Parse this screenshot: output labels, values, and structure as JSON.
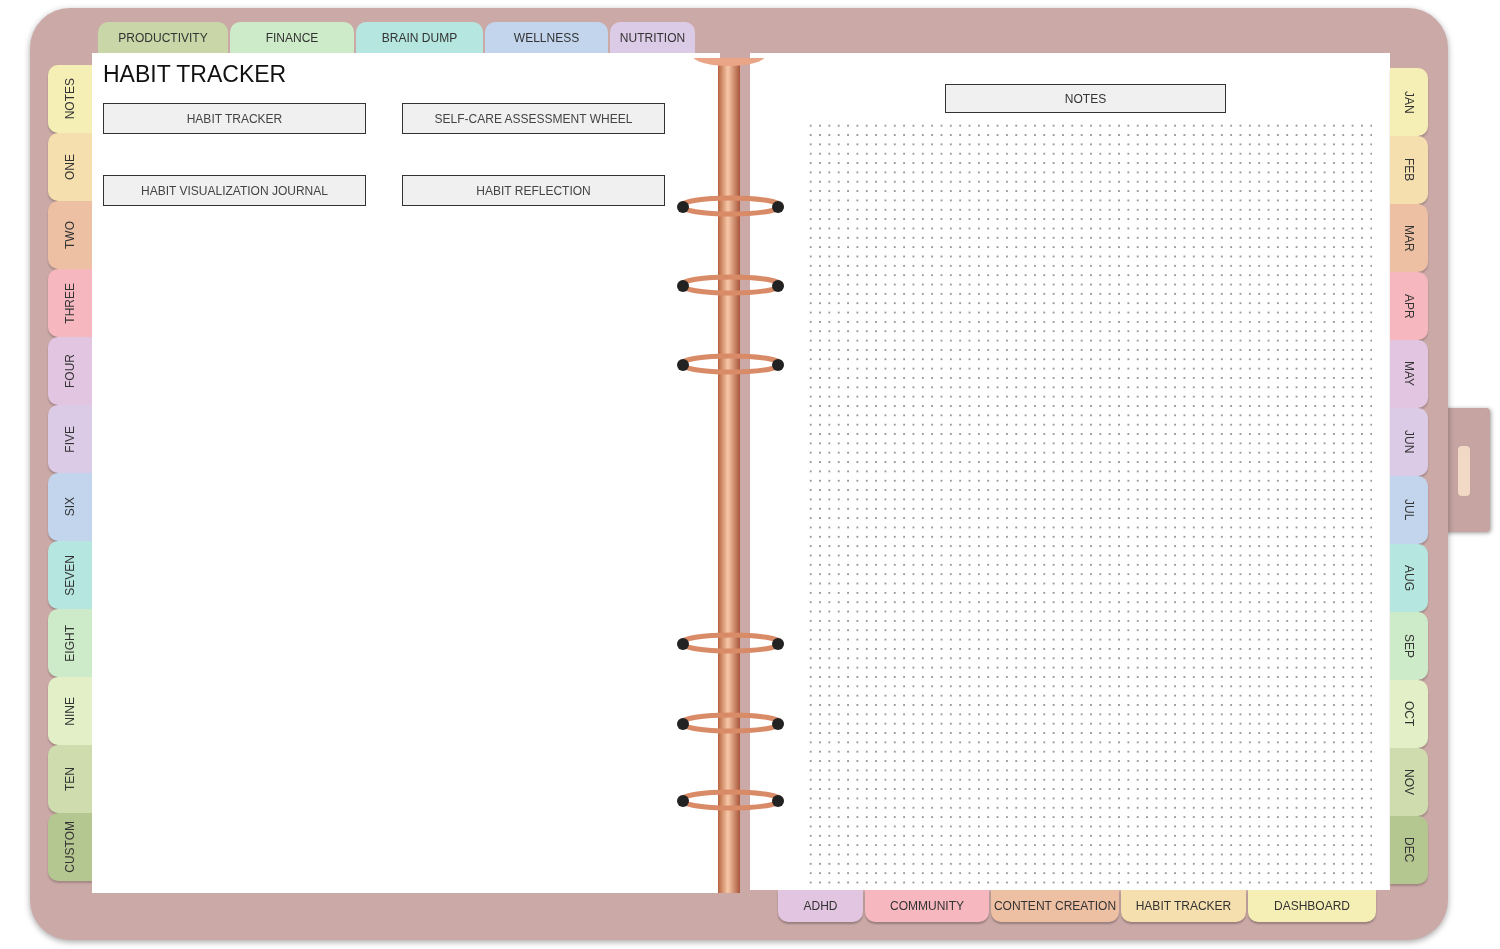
{
  "top_tabs": [
    {
      "label": "PRODUCTIVITY",
      "color": "#c9d6a8"
    },
    {
      "label": "FINANCE",
      "color": "#cdebc8"
    },
    {
      "label": "BRAIN DUMP",
      "color": "#b5e6df"
    },
    {
      "label": "WELLNESS",
      "color": "#c2d5ec"
    },
    {
      "label": "NUTRITION",
      "color": "#dccbe6"
    }
  ],
  "left_tabs": [
    {
      "label": "NOTES",
      "color": "#f5efb5"
    },
    {
      "label": "ONE",
      "color": "#f6dfae"
    },
    {
      "label": "TWO",
      "color": "#edc0a4"
    },
    {
      "label": "THREE",
      "color": "#f6b7bf"
    },
    {
      "label": "FOUR",
      "color": "#e2c5e0"
    },
    {
      "label": "FIVE",
      "color": "#dccbe6"
    },
    {
      "label": "SIX",
      "color": "#c2d5ec"
    },
    {
      "label": "SEVEN",
      "color": "#b5e6df"
    },
    {
      "label": "EIGHT",
      "color": "#cdebc8"
    },
    {
      "label": "NINE",
      "color": "#e3efc6"
    },
    {
      "label": "TEN",
      "color": "#cfdcae"
    },
    {
      "label": "CUSTOM",
      "color": "#b5c790"
    }
  ],
  "left_page": {
    "title": "HABIT TRACKER",
    "links": [
      "HABIT TRACKER",
      "SELF-CARE ASSESSMENT WHEEL",
      "HABIT VISUALIZATION JOURNAL",
      "HABIT REFLECTION"
    ]
  },
  "right_page": {
    "notes_label": "NOTES"
  },
  "right_tabs": [
    {
      "label": "JAN",
      "color": "#f5efb5"
    },
    {
      "label": "FEB",
      "color": "#f6dfae"
    },
    {
      "label": "MAR",
      "color": "#edc0a4"
    },
    {
      "label": "APR",
      "color": "#f6b7bf"
    },
    {
      "label": "MAY",
      "color": "#e2c5e0"
    },
    {
      "label": "JUN",
      "color": "#dccbe6"
    },
    {
      "label": "JUL",
      "color": "#c2d5ec"
    },
    {
      "label": "AUG",
      "color": "#b5e6df"
    },
    {
      "label": "SEP",
      "color": "#cdebc8"
    },
    {
      "label": "OCT",
      "color": "#e3efc6"
    },
    {
      "label": "NOV",
      "color": "#cfdcae"
    },
    {
      "label": "DEC",
      "color": "#b5c790"
    }
  ],
  "bottom_tabs": [
    {
      "label": "ADHD",
      "color": "#e2c5e0"
    },
    {
      "label": "COMMUNITY",
      "color": "#f6b7bf"
    },
    {
      "label": "CONTENT CREATION",
      "color": "#edc0a4"
    },
    {
      "label": "HABIT TRACKER",
      "color": "#f6dfae"
    },
    {
      "label": "DASHBOARD",
      "color": "#f5efb5"
    }
  ]
}
